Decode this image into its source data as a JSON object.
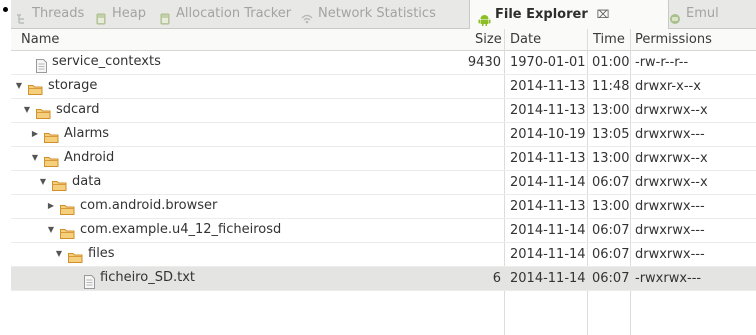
{
  "tabs": [
    {
      "label": "Threads",
      "icon": "threads-icon"
    },
    {
      "label": "Heap",
      "icon": "heap-icon"
    },
    {
      "label": "Allocation Tracker",
      "icon": "allocation-tracker-icon"
    },
    {
      "label": "Network Statistics",
      "icon": "network-statistics-icon"
    },
    {
      "label": "File Explorer",
      "icon": "android-icon",
      "close": "⌧"
    },
    {
      "label": "Emul",
      "icon": "emulator-icon"
    }
  ],
  "columns": {
    "name": "Name",
    "size": "Size",
    "date": "Date",
    "time": "Time",
    "permissions": "Permissions"
  },
  "rows": [
    {
      "name": "service_contexts",
      "size": "9430",
      "date": "1970-01-01",
      "time": "01:00",
      "perm": "-rw-r--r--",
      "type": "file",
      "toggle": ""
    },
    {
      "name": "storage",
      "size": "",
      "date": "2014-11-13",
      "time": "11:48",
      "perm": "drwxr-x--x",
      "type": "folder",
      "toggle": "▼"
    },
    {
      "name": "sdcard",
      "size": "",
      "date": "2014-11-13",
      "time": "13:00",
      "perm": "drwxrwx--x",
      "type": "folder",
      "toggle": "▼"
    },
    {
      "name": "Alarms",
      "size": "",
      "date": "2014-10-19",
      "time": "13:05",
      "perm": "drwxrwx---",
      "type": "folder",
      "toggle": "▶"
    },
    {
      "name": "Android",
      "size": "",
      "date": "2014-11-13",
      "time": "13:00",
      "perm": "drwxrwx--x",
      "type": "folder",
      "toggle": "▼"
    },
    {
      "name": "data",
      "size": "",
      "date": "2014-11-14",
      "time": "06:07",
      "perm": "drwxrwx--x",
      "type": "folder",
      "toggle": "▼"
    },
    {
      "name": "com.android.browser",
      "size": "",
      "date": "2014-11-13",
      "time": "13:00",
      "perm": "drwxrwx---",
      "type": "folder",
      "toggle": "▶"
    },
    {
      "name": "com.example.u4_12_ficheirosd",
      "size": "",
      "date": "2014-11-14",
      "time": "06:07",
      "perm": "drwxrwx---",
      "type": "folder",
      "toggle": "▼"
    },
    {
      "name": "files",
      "size": "",
      "date": "2014-11-14",
      "time": "06:07",
      "perm": "drwxrwx---",
      "type": "folder",
      "toggle": "▼"
    },
    {
      "name": "ficheiro_SD.txt",
      "size": "6",
      "date": "2014-11-14",
      "time": "06:07",
      "perm": "-rwxrwx---",
      "type": "file",
      "toggle": ""
    }
  ],
  "colors": {
    "folder": "#e5a23b",
    "android": "#8cbf26",
    "selected_row": "#e4e4e2"
  }
}
